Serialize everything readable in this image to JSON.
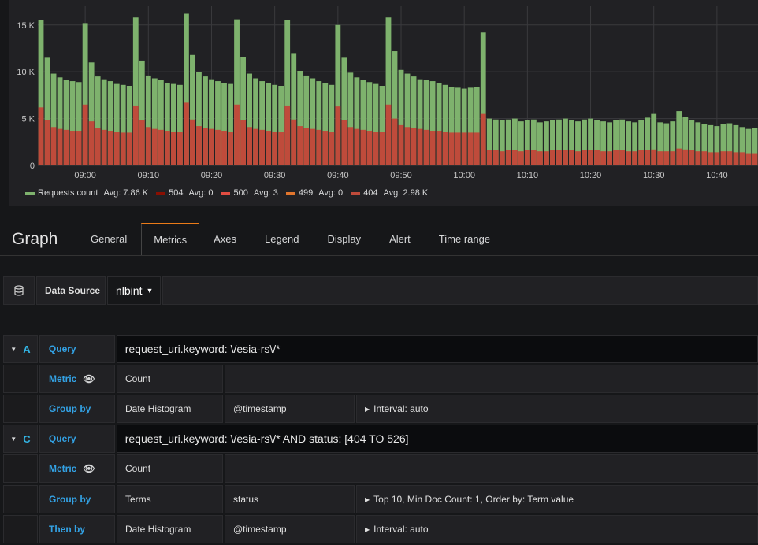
{
  "chart_data": {
    "type": "bar",
    "stacked": true,
    "title": "",
    "xlabel": "",
    "ylabel": "",
    "ylim": [
      0,
      17000
    ],
    "yticks": [
      0,
      5000,
      10000,
      15000
    ],
    "ytick_labels": [
      "0",
      "5 K",
      "10 K",
      "15 K"
    ],
    "xtick_labels": [
      "09:00",
      "09:10",
      "09:20",
      "09:30",
      "09:40",
      "09:50",
      "10:00",
      "10:10",
      "10:20",
      "10:30",
      "10:40"
    ],
    "grid": true,
    "legend_position": "bottom",
    "x": [
      "08:53",
      "08:54",
      "08:55",
      "08:56",
      "08:57",
      "08:58",
      "08:59",
      "09:00",
      "09:01",
      "09:02",
      "09:03",
      "09:04",
      "09:05",
      "09:06",
      "09:07",
      "09:08",
      "09:09",
      "09:10",
      "09:11",
      "09:12",
      "09:13",
      "09:14",
      "09:15",
      "09:16",
      "09:17",
      "09:18",
      "09:19",
      "09:20",
      "09:21",
      "09:22",
      "09:23",
      "09:24",
      "09:25",
      "09:26",
      "09:27",
      "09:28",
      "09:29",
      "09:30",
      "09:31",
      "09:32",
      "09:33",
      "09:34",
      "09:35",
      "09:36",
      "09:37",
      "09:38",
      "09:39",
      "09:40",
      "09:41",
      "09:42",
      "09:43",
      "09:44",
      "09:45",
      "09:46",
      "09:47",
      "09:48",
      "09:49",
      "09:50",
      "09:51",
      "09:52",
      "09:53",
      "09:54",
      "09:55",
      "09:56",
      "09:57",
      "09:58",
      "09:59",
      "10:00",
      "10:01",
      "10:02",
      "10:03",
      "10:04",
      "10:05",
      "10:06",
      "10:07",
      "10:08",
      "10:09",
      "10:10",
      "10:11",
      "10:12",
      "10:13",
      "10:14",
      "10:15",
      "10:16",
      "10:17",
      "10:18",
      "10:19",
      "10:20",
      "10:21",
      "10:22",
      "10:23",
      "10:24",
      "10:25",
      "10:26",
      "10:27",
      "10:28",
      "10:29",
      "10:30",
      "10:31",
      "10:32",
      "10:33",
      "10:34",
      "10:35",
      "10:36",
      "10:37",
      "10:38",
      "10:39",
      "10:40",
      "10:41",
      "10:42",
      "10:43",
      "10:44",
      "10:45",
      "10:46"
    ],
    "series": [
      {
        "name": "Requests count",
        "color": "#7eb26d",
        "values": [
          15500,
          11500,
          9800,
          9400,
          9100,
          9000,
          8900,
          15200,
          11000,
          9500,
          9200,
          9000,
          8700,
          8600,
          8500,
          15800,
          11200,
          9600,
          9300,
          9100,
          8800,
          8700,
          8600,
          16200,
          11800,
          10000,
          9500,
          9200,
          9000,
          8800,
          8700,
          15600,
          11600,
          9800,
          9300,
          9000,
          8800,
          8600,
          8500,
          15500,
          12000,
          10100,
          9600,
          9300,
          9000,
          8800,
          8600,
          15000,
          11500,
          9900,
          9400,
          9100,
          8900,
          8700,
          8500,
          15800,
          12200,
          10200,
          9800,
          9500,
          9200,
          9100,
          9000,
          8800,
          8600,
          8400,
          8300,
          8200,
          8300,
          8400,
          14200,
          5000,
          4900,
          4800,
          4900,
          5000,
          4700,
          4800,
          4900,
          4600,
          4700,
          4800,
          4900,
          5000,
          4800,
          4700,
          4900,
          5000,
          4800,
          4700,
          4600,
          4800,
          4900,
          4700,
          4600,
          4800,
          5100,
          5500,
          4600,
          4500,
          4700,
          5800,
          5200,
          4800,
          4600,
          4400,
          4300,
          4200,
          4400,
          4500,
          4300,
          4100,
          3900,
          4000,
          4200,
          4100,
          4300,
          5500
        ]
      },
      {
        "name": "504",
        "color": "#890f02",
        "values": []
      },
      {
        "name": "500",
        "color": "#e24d42",
        "values": []
      },
      {
        "name": "499",
        "color": "#e0752d",
        "values": []
      },
      {
        "name": "404",
        "color": "#bf4b3b",
        "values": [
          6200,
          4800,
          4100,
          3900,
          3800,
          3700,
          3700,
          6500,
          4700,
          4000,
          3800,
          3700,
          3600,
          3500,
          3500,
          6400,
          4800,
          4100,
          3900,
          3800,
          3700,
          3600,
          3600,
          6700,
          4900,
          4200,
          4000,
          3900,
          3800,
          3700,
          3600,
          6500,
          4800,
          4100,
          3900,
          3800,
          3700,
          3600,
          3600,
          6400,
          4900,
          4200,
          4000,
          3900,
          3800,
          3700,
          3600,
          6300,
          4800,
          4100,
          3900,
          3800,
          3700,
          3600,
          3600,
          6500,
          5000,
          4300,
          4100,
          4000,
          3900,
          3800,
          3700,
          3700,
          3600,
          3500,
          3500,
          3500,
          3500,
          3500,
          5500,
          1600,
          1600,
          1500,
          1600,
          1600,
          1500,
          1600,
          1600,
          1500,
          1500,
          1600,
          1600,
          1600,
          1600,
          1500,
          1600,
          1600,
          1600,
          1500,
          1500,
          1600,
          1600,
          1500,
          1500,
          1600,
          1600,
          1700,
          1500,
          1500,
          1500,
          1800,
          1700,
          1600,
          1500,
          1500,
          1400,
          1400,
          1500,
          1500,
          1400,
          1400,
          1300,
          1300,
          1400,
          1400,
          1400,
          1800
        ]
      }
    ]
  },
  "legend": [
    {
      "name": "Requests count",
      "avg": "Avg: 7.86 K",
      "color": "#7eb26d"
    },
    {
      "name": "504",
      "avg": "Avg: 0",
      "color": "#890f02"
    },
    {
      "name": "500",
      "avg": "Avg: 3",
      "color": "#e24d42"
    },
    {
      "name": "499",
      "avg": "Avg: 0",
      "color": "#e0752d"
    },
    {
      "name": "404",
      "avg": "Avg: 2.98 K",
      "color": "#bf4b3b"
    }
  ],
  "editor": {
    "title": "Graph",
    "tabs": [
      "General",
      "Metrics",
      "Axes",
      "Legend",
      "Display",
      "Alert",
      "Time range"
    ],
    "active_tab": "Metrics"
  },
  "datasource": {
    "icon": "database-icon",
    "label": "Data Source",
    "value": "nlbint"
  },
  "queryA": {
    "letter": "A",
    "query_label": "Query",
    "query": "request_uri.keyword: \\/esia-rs\\/*",
    "metric_label": "Metric",
    "metric": "Count",
    "groupby_label": "Group by",
    "groupby_type": "Date Histogram",
    "groupby_field": "@timestamp",
    "groupby_options": "Interval: auto"
  },
  "queryC": {
    "letter": "C",
    "query_label": "Query",
    "query": "request_uri.keyword: \\/esia-rs\\/* AND status: [404 TO 526]",
    "metric_label": "Metric",
    "metric": "Count",
    "groupby_label": "Group by",
    "groupby_type": "Terms",
    "groupby_field": "status",
    "groupby_options": "Top 10, Min Doc Count: 1, Order by: Term value",
    "thenby_label": "Then by",
    "thenby_type": "Date Histogram",
    "thenby_field": "@timestamp",
    "thenby_options": "Interval: auto"
  }
}
